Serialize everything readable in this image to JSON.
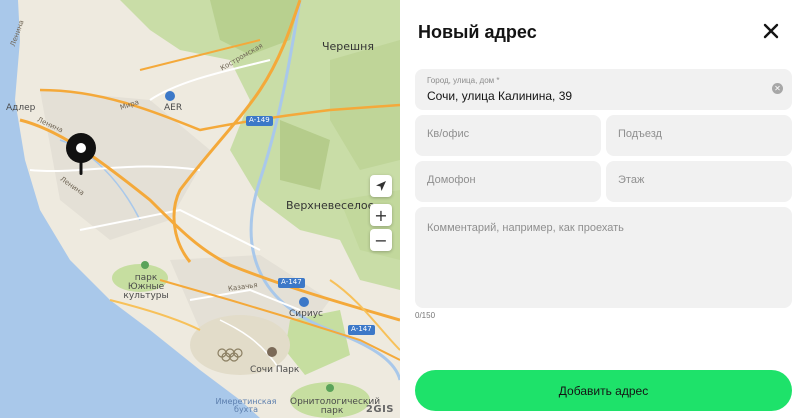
{
  "map": {
    "labels": {
      "chereshnya": "Черешня",
      "verkhnevesseloe": "Верхневеселое",
      "adler": "Адлер",
      "lenina_1": "Ленина",
      "lenina_2": "Ленина",
      "lenina_3": "Ленина",
      "mira": "Мира",
      "kostromskaya": "Костромская",
      "aer": "AER",
      "park_yuzhnye_kultury": "парк Южные культуры",
      "kazachya": "Казачья",
      "sirius": "Сириус",
      "sochi_park": "Сочи Парк",
      "imeretinskaya_bukhta": "Имеретинская бухта",
      "ornitologicheskiy_park": "Орнитологический парк"
    },
    "road_badges": {
      "a149": "А-149",
      "a147_1": "А-147",
      "a147_2": "А-147"
    },
    "brand": "2GIS",
    "zoom_in": "+",
    "zoom_out": "−",
    "colors": {
      "sea": "#a9c8ea",
      "land": "#eeeadf",
      "hills": "#c9dda7",
      "main_road": "#f4a93a",
      "road": "#ffffff",
      "urban": "#e4e0d6"
    }
  },
  "panel": {
    "title": "Новый адрес",
    "close_icon": "×",
    "address_label": "Город, улица, дом *",
    "address_value": "Сочи, улица Калинина, 39",
    "office_placeholder": "Кв/офис",
    "entrance_placeholder": "Подъезд",
    "intercom_placeholder": "Домофон",
    "floor_placeholder": "Этаж",
    "comment_placeholder": "Комментарий, например, как проехать",
    "counter": "0/150",
    "submit_label": "Добавить адрес",
    "accent_color": "#1ee26a"
  }
}
